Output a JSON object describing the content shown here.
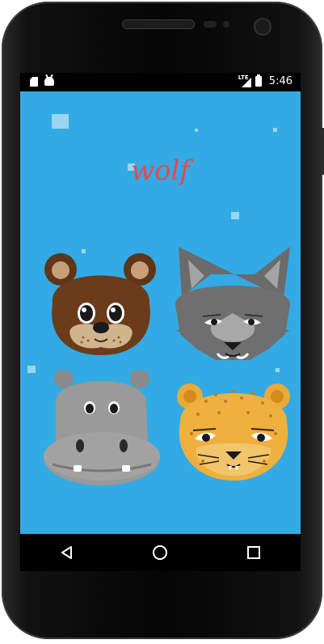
{
  "status_bar": {
    "network": "LTE",
    "time": "5:46"
  },
  "app": {
    "title": "wolf",
    "background_color": "#33aae3",
    "title_color": "#e8474d",
    "animals": [
      {
        "name": "otter",
        "icon": "otter-face"
      },
      {
        "name": "wolf",
        "icon": "wolf-face"
      },
      {
        "name": "hippo",
        "icon": "hippo-face"
      },
      {
        "name": "leopard",
        "icon": "leopard-face"
      }
    ]
  },
  "nav_bar": {
    "buttons": [
      "back",
      "home",
      "recents"
    ]
  }
}
